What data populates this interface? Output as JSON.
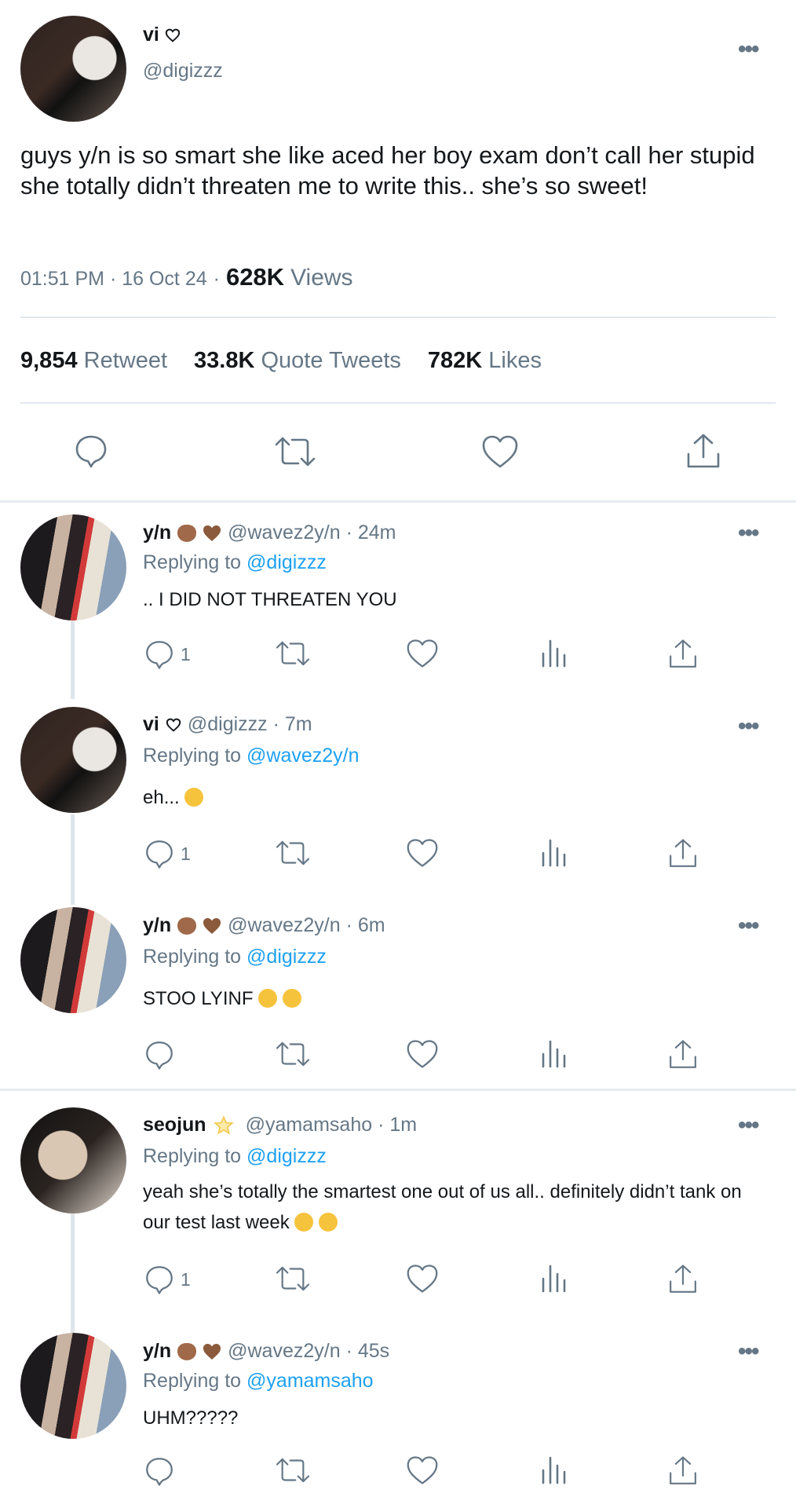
{
  "main_tweet": {
    "name": "vi",
    "handle": "@digizzz",
    "text": "guys y/n is so smart she like aced her boy exam don’t call her stupid she totally didn’t threaten me to write this.. she’s so sweet!",
    "time": "01:51 PM · 16 Oct 24",
    "dot": "·",
    "views_count": "628K",
    "views_label": "Views",
    "retweets_count": "9,854",
    "retweets_label": "Retweet",
    "quotes_count": "33.8K",
    "quotes_label": "Quote Tweets",
    "likes_count": "782K",
    "likes_label": "Likes",
    "more": "•••"
  },
  "replies": [
    {
      "name": "y/n",
      "handle": "@wavez2y/n · 24m",
      "replying_label": "Replying to",
      "replying_to": "@digizzz",
      "text": ".. I DID NOT THREATEN YOU",
      "reply_count": "1"
    },
    {
      "name": "vi",
      "handle": "@digizzz · 7m",
      "replying_label": "Replying to",
      "replying_to": "@wavez2y/n",
      "text": "eh...",
      "reply_count": "1"
    },
    {
      "name": "y/n",
      "handle": "@wavez2y/n · 6m",
      "replying_label": "Replying to",
      "replying_to": "@digizzz",
      "text": "STOO LYINF",
      "reply_count": ""
    },
    {
      "name": "seojun",
      "handle": "@yamamsaho · 1m",
      "replying_label": "Replying to",
      "replying_to": "@digizzz",
      "text": "yeah she’s totally the smartest one out of us all.. definitely didn’t tank on our test last week",
      "reply_count": "1"
    },
    {
      "name": "y/n",
      "handle": "@wavez2y/n · 45s",
      "replying_label": "Replying to",
      "replying_to": "@yamamsaho",
      "text": "UHM?????",
      "reply_count": ""
    }
  ],
  "colors": {
    "accent": "#1da1f2",
    "secondary_text": "#657786",
    "divider": "#e1e8ed"
  }
}
